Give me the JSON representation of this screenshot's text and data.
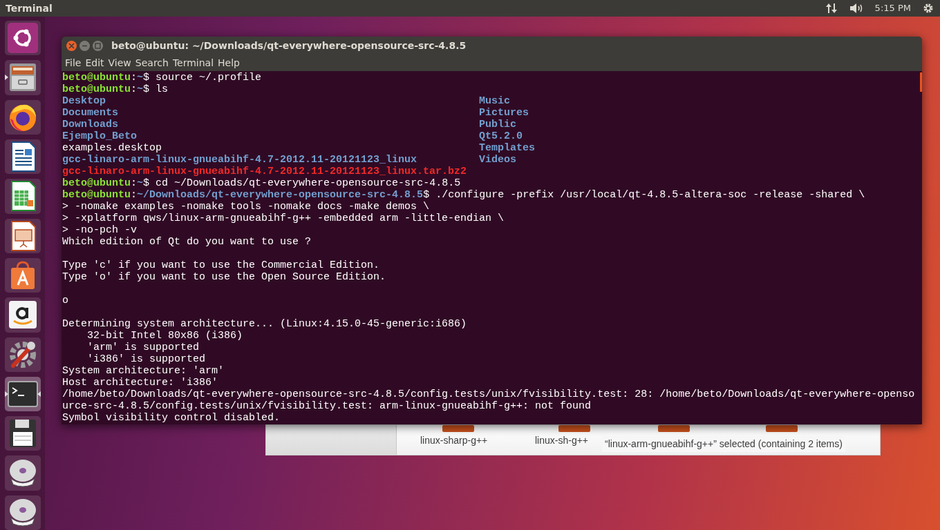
{
  "top_panel": {
    "app_title": "Terminal",
    "time": "5:15 PM"
  },
  "launcher": {
    "items": [
      {
        "kind": "ubuntu",
        "running": false,
        "focused": false
      },
      {
        "kind": "files",
        "running": true,
        "focused": false
      },
      {
        "kind": "firefox",
        "running": false,
        "focused": false
      },
      {
        "kind": "writer",
        "running": false,
        "focused": false
      },
      {
        "kind": "calc",
        "running": false,
        "focused": false
      },
      {
        "kind": "impress",
        "running": false,
        "focused": false
      },
      {
        "kind": "store",
        "running": false,
        "focused": false
      },
      {
        "kind": "amazon",
        "running": false,
        "focused": false
      },
      {
        "kind": "settings",
        "running": false,
        "focused": false
      },
      {
        "kind": "terminal",
        "running": true,
        "focused": true
      },
      {
        "kind": "disk",
        "running": false,
        "focused": false
      },
      {
        "kind": "dvd",
        "running": false,
        "focused": false
      },
      {
        "kind": "dvd",
        "running": false,
        "focused": false
      }
    ]
  },
  "terminal": {
    "title": "beto@ubuntu: ~/Downloads/qt-everywhere-opensource-src-4.8.5",
    "menu": [
      "File",
      "Edit",
      "View",
      "Search",
      "Terminal",
      "Help"
    ],
    "lines": [
      {
        "kind": "cmd",
        "segments": [
          {
            "kind": "user",
            "text": "beto@ubuntu"
          },
          {
            "kind": "plain",
            "text": ":"
          },
          {
            "kind": "path",
            "text": "~"
          },
          {
            "kind": "plain",
            "text": "$ source ~/.profile"
          }
        ]
      },
      {
        "kind": "cmd",
        "segments": [
          {
            "kind": "user",
            "text": "beto@ubuntu"
          },
          {
            "kind": "plain",
            "text": ":"
          },
          {
            "kind": "path",
            "text": "~"
          },
          {
            "kind": "plain",
            "text": "$ ls"
          }
        ]
      },
      {
        "kind": "ls",
        "left": {
          "text": "Desktop",
          "kind": "dir"
        },
        "right": {
          "text": "Music",
          "kind": "dir"
        }
      },
      {
        "kind": "ls",
        "left": {
          "text": "Documents",
          "kind": "dir"
        },
        "right": {
          "text": "Pictures",
          "kind": "dir"
        }
      },
      {
        "kind": "ls",
        "left": {
          "text": "Downloads",
          "kind": "dir"
        },
        "right": {
          "text": "Public",
          "kind": "dir"
        }
      },
      {
        "kind": "ls",
        "left": {
          "text": "Ejemplo_Beto",
          "kind": "dir"
        },
        "right": {
          "text": "Qt5.2.0",
          "kind": "dir"
        }
      },
      {
        "kind": "ls",
        "left": {
          "text": "examples.desktop",
          "kind": "file"
        },
        "right": {
          "text": "Templates",
          "kind": "dir"
        }
      },
      {
        "kind": "ls",
        "left": {
          "text": "gcc-linaro-arm-linux-gnueabihf-4.7-2012.11-20121123_linux",
          "kind": "dir"
        },
        "right": {
          "text": "Videos",
          "kind": "dir"
        }
      },
      {
        "kind": "ls",
        "left": {
          "text": "gcc-linaro-arm-linux-gnueabihf-4.7-2012.11-20121123_linux.tar.bz2",
          "kind": "archive"
        }
      },
      {
        "kind": "cmd",
        "segments": [
          {
            "kind": "user",
            "text": "beto@ubuntu"
          },
          {
            "kind": "plain",
            "text": ":"
          },
          {
            "kind": "path",
            "text": "~"
          },
          {
            "kind": "plain",
            "text": "$ cd ~/Downloads/qt-everywhere-opensource-src-4.8.5"
          }
        ]
      },
      {
        "kind": "cmd",
        "segments": [
          {
            "kind": "user",
            "text": "beto@ubuntu"
          },
          {
            "kind": "plain",
            "text": ":"
          },
          {
            "kind": "path",
            "text": "~/Downloads/qt-everywhere-opensource-src-4.8.5"
          },
          {
            "kind": "plain",
            "text": "$ ./configure -prefix /usr/local/qt-4.8.5-altera-soc -release -shared \\"
          }
        ]
      },
      {
        "kind": "out",
        "text": "> -nomake examples -nomake tools -nomake docs -make demos \\"
      },
      {
        "kind": "out",
        "text": "> -xplatform qws/linux-arm-gnueabihf-g++ -embedded arm -little-endian \\"
      },
      {
        "kind": "out",
        "text": "> -no-pch -v"
      },
      {
        "kind": "out",
        "text": "Which edition of Qt do you want to use ?"
      },
      {
        "kind": "blank"
      },
      {
        "kind": "out",
        "text": "Type 'c' if you want to use the Commercial Edition."
      },
      {
        "kind": "out",
        "text": "Type 'o' if you want to use the Open Source Edition."
      },
      {
        "kind": "blank"
      },
      {
        "kind": "out",
        "text": "o"
      },
      {
        "kind": "blank"
      },
      {
        "kind": "out",
        "text": "Determining system architecture... (Linux:4.15.0-45-generic:i686)"
      },
      {
        "kind": "out",
        "text": "    32-bit Intel 80x86 (i386)"
      },
      {
        "kind": "out",
        "text": "    'arm' is supported"
      },
      {
        "kind": "out",
        "text": "    'i386' is supported"
      },
      {
        "kind": "out",
        "text": "System architecture: 'arm'"
      },
      {
        "kind": "out",
        "text": "Host architecture: 'i386'"
      },
      {
        "kind": "out",
        "text": "/home/beto/Downloads/qt-everywhere-opensource-src-4.8.5/config.tests/unix/fvisibility.test: 28: /home/beto/Downloads/qt-everywhere-openso"
      },
      {
        "kind": "out",
        "text": "urce-src-4.8.5/config.tests/unix/fvisibility.test: arm-linux-gnueabihf-g++: not found"
      },
      {
        "kind": "out",
        "text": "Symbol visibility control disabled."
      }
    ]
  },
  "file_manager": {
    "items": [
      "linux-sharp-g++",
      "linux-sh-g++"
    ],
    "status": "“linux-arm-gnueabihf-g++” selected  (containing 2 items)"
  }
}
